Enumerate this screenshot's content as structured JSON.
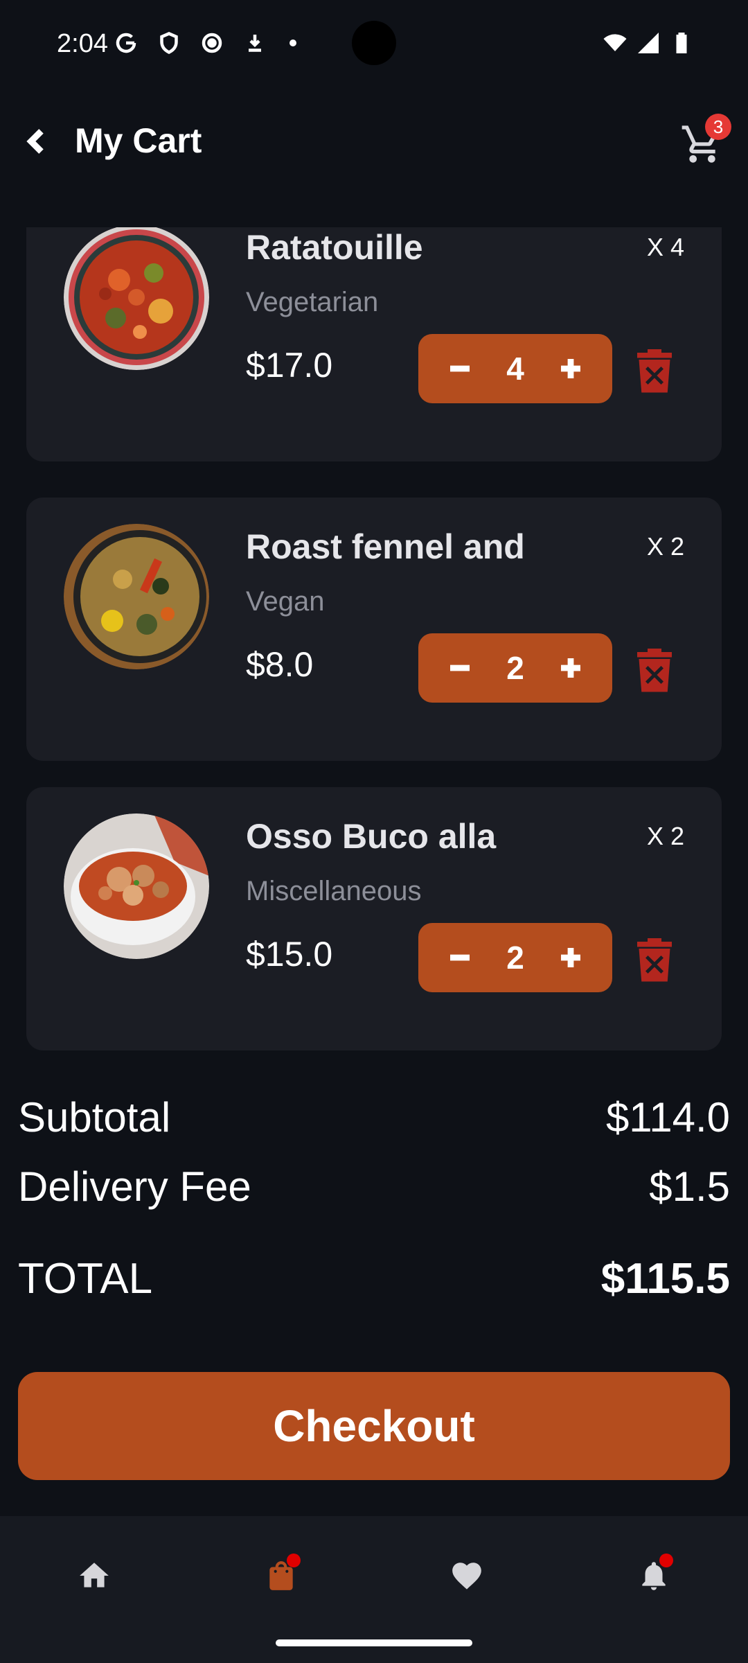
{
  "status_bar": {
    "time": "2:04"
  },
  "header": {
    "title": "My Cart",
    "cart_badge_count": "3"
  },
  "cart": {
    "items": [
      {
        "name": "Ratatouille",
        "category": "Vegetarian",
        "price": "$17.0",
        "multiplier": "X 4",
        "quantity": "4"
      },
      {
        "name": "Roast fennel and",
        "category": "Vegan",
        "price": "$8.0",
        "multiplier": "X 2",
        "quantity": "2"
      },
      {
        "name": "Osso Buco alla",
        "category": "Miscellaneous",
        "price": "$15.0",
        "multiplier": "X 2",
        "quantity": "2"
      }
    ]
  },
  "summary": {
    "subtotal_label": "Subtotal",
    "subtotal_value": "$114.0",
    "delivery_label": "Delivery Fee",
    "delivery_value": "$1.5",
    "total_label": "TOTAL",
    "total_value": "$115.5"
  },
  "checkout": {
    "label": "Checkout"
  },
  "bottom_nav": {
    "items": [
      {
        "icon": "home-icon",
        "active": false
      },
      {
        "icon": "shopping-bag-icon",
        "active": true
      },
      {
        "icon": "heart-icon",
        "active": false
      },
      {
        "icon": "bell-icon",
        "active": false
      }
    ]
  },
  "colors": {
    "background": "#0e1117",
    "card": "#1b1d24",
    "accent": "#b44d1e",
    "delete": "#b3261e",
    "badge": "#e53935"
  }
}
